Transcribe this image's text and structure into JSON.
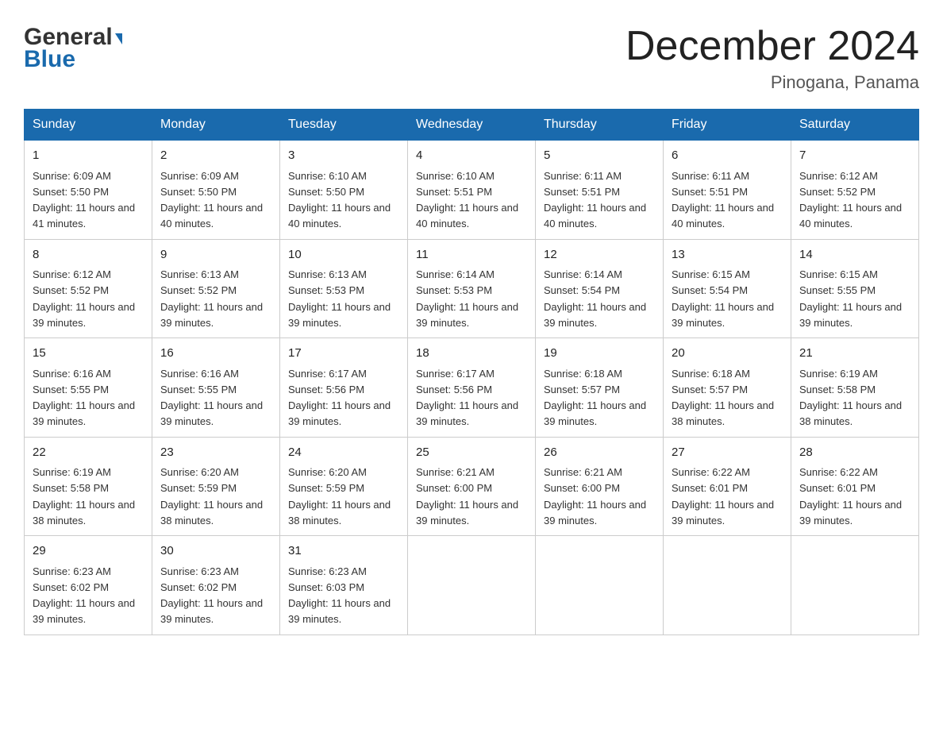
{
  "header": {
    "logo_general": "General",
    "logo_blue": "Blue",
    "main_title": "December 2024",
    "subtitle": "Pinogana, Panama"
  },
  "days_of_week": [
    "Sunday",
    "Monday",
    "Tuesday",
    "Wednesday",
    "Thursday",
    "Friday",
    "Saturday"
  ],
  "weeks": [
    [
      {
        "day": "1",
        "sunrise": "6:09 AM",
        "sunset": "5:50 PM",
        "daylight": "11 hours and 41 minutes."
      },
      {
        "day": "2",
        "sunrise": "6:09 AM",
        "sunset": "5:50 PM",
        "daylight": "11 hours and 40 minutes."
      },
      {
        "day": "3",
        "sunrise": "6:10 AM",
        "sunset": "5:50 PM",
        "daylight": "11 hours and 40 minutes."
      },
      {
        "day": "4",
        "sunrise": "6:10 AM",
        "sunset": "5:51 PM",
        "daylight": "11 hours and 40 minutes."
      },
      {
        "day": "5",
        "sunrise": "6:11 AM",
        "sunset": "5:51 PM",
        "daylight": "11 hours and 40 minutes."
      },
      {
        "day": "6",
        "sunrise": "6:11 AM",
        "sunset": "5:51 PM",
        "daylight": "11 hours and 40 minutes."
      },
      {
        "day": "7",
        "sunrise": "6:12 AM",
        "sunset": "5:52 PM",
        "daylight": "11 hours and 40 minutes."
      }
    ],
    [
      {
        "day": "8",
        "sunrise": "6:12 AM",
        "sunset": "5:52 PM",
        "daylight": "11 hours and 39 minutes."
      },
      {
        "day": "9",
        "sunrise": "6:13 AM",
        "sunset": "5:52 PM",
        "daylight": "11 hours and 39 minutes."
      },
      {
        "day": "10",
        "sunrise": "6:13 AM",
        "sunset": "5:53 PM",
        "daylight": "11 hours and 39 minutes."
      },
      {
        "day": "11",
        "sunrise": "6:14 AM",
        "sunset": "5:53 PM",
        "daylight": "11 hours and 39 minutes."
      },
      {
        "day": "12",
        "sunrise": "6:14 AM",
        "sunset": "5:54 PM",
        "daylight": "11 hours and 39 minutes."
      },
      {
        "day": "13",
        "sunrise": "6:15 AM",
        "sunset": "5:54 PM",
        "daylight": "11 hours and 39 minutes."
      },
      {
        "day": "14",
        "sunrise": "6:15 AM",
        "sunset": "5:55 PM",
        "daylight": "11 hours and 39 minutes."
      }
    ],
    [
      {
        "day": "15",
        "sunrise": "6:16 AM",
        "sunset": "5:55 PM",
        "daylight": "11 hours and 39 minutes."
      },
      {
        "day": "16",
        "sunrise": "6:16 AM",
        "sunset": "5:55 PM",
        "daylight": "11 hours and 39 minutes."
      },
      {
        "day": "17",
        "sunrise": "6:17 AM",
        "sunset": "5:56 PM",
        "daylight": "11 hours and 39 minutes."
      },
      {
        "day": "18",
        "sunrise": "6:17 AM",
        "sunset": "5:56 PM",
        "daylight": "11 hours and 39 minutes."
      },
      {
        "day": "19",
        "sunrise": "6:18 AM",
        "sunset": "5:57 PM",
        "daylight": "11 hours and 39 minutes."
      },
      {
        "day": "20",
        "sunrise": "6:18 AM",
        "sunset": "5:57 PM",
        "daylight": "11 hours and 38 minutes."
      },
      {
        "day": "21",
        "sunrise": "6:19 AM",
        "sunset": "5:58 PM",
        "daylight": "11 hours and 38 minutes."
      }
    ],
    [
      {
        "day": "22",
        "sunrise": "6:19 AM",
        "sunset": "5:58 PM",
        "daylight": "11 hours and 38 minutes."
      },
      {
        "day": "23",
        "sunrise": "6:20 AM",
        "sunset": "5:59 PM",
        "daylight": "11 hours and 38 minutes."
      },
      {
        "day": "24",
        "sunrise": "6:20 AM",
        "sunset": "5:59 PM",
        "daylight": "11 hours and 38 minutes."
      },
      {
        "day": "25",
        "sunrise": "6:21 AM",
        "sunset": "6:00 PM",
        "daylight": "11 hours and 39 minutes."
      },
      {
        "day": "26",
        "sunrise": "6:21 AM",
        "sunset": "6:00 PM",
        "daylight": "11 hours and 39 minutes."
      },
      {
        "day": "27",
        "sunrise": "6:22 AM",
        "sunset": "6:01 PM",
        "daylight": "11 hours and 39 minutes."
      },
      {
        "day": "28",
        "sunrise": "6:22 AM",
        "sunset": "6:01 PM",
        "daylight": "11 hours and 39 minutes."
      }
    ],
    [
      {
        "day": "29",
        "sunrise": "6:23 AM",
        "sunset": "6:02 PM",
        "daylight": "11 hours and 39 minutes."
      },
      {
        "day": "30",
        "sunrise": "6:23 AM",
        "sunset": "6:02 PM",
        "daylight": "11 hours and 39 minutes."
      },
      {
        "day": "31",
        "sunrise": "6:23 AM",
        "sunset": "6:03 PM",
        "daylight": "11 hours and 39 minutes."
      },
      null,
      null,
      null,
      null
    ]
  ]
}
